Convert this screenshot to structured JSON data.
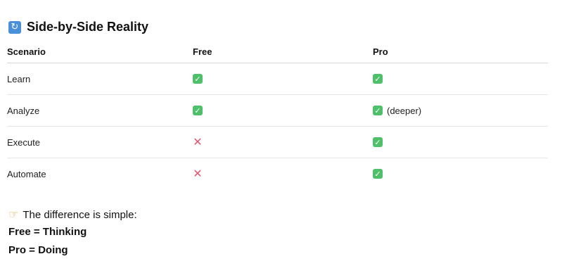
{
  "heading": {
    "icon": "refresh-arrows-icon",
    "title": "Side-by-Side Reality"
  },
  "table": {
    "columns": [
      "Scenario",
      "Free",
      "Pro"
    ],
    "rows": [
      {
        "scenario": "Learn",
        "free": "check",
        "pro": "check",
        "pro_note": ""
      },
      {
        "scenario": "Analyze",
        "free": "check",
        "pro": "check",
        "pro_note": "(deeper)"
      },
      {
        "scenario": "Execute",
        "free": "cross",
        "pro": "check",
        "pro_note": ""
      },
      {
        "scenario": "Automate",
        "free": "cross",
        "pro": "check",
        "pro_note": ""
      }
    ]
  },
  "summary": {
    "icon": "pointing-hand-icon",
    "intro": "The difference is simple:",
    "line1": "Free = Thinking",
    "line2": "Pro = Doing"
  },
  "colors": {
    "check": "#4fbf6a",
    "cross": "#e0566b",
    "heading_icon": "#4a90d9"
  }
}
